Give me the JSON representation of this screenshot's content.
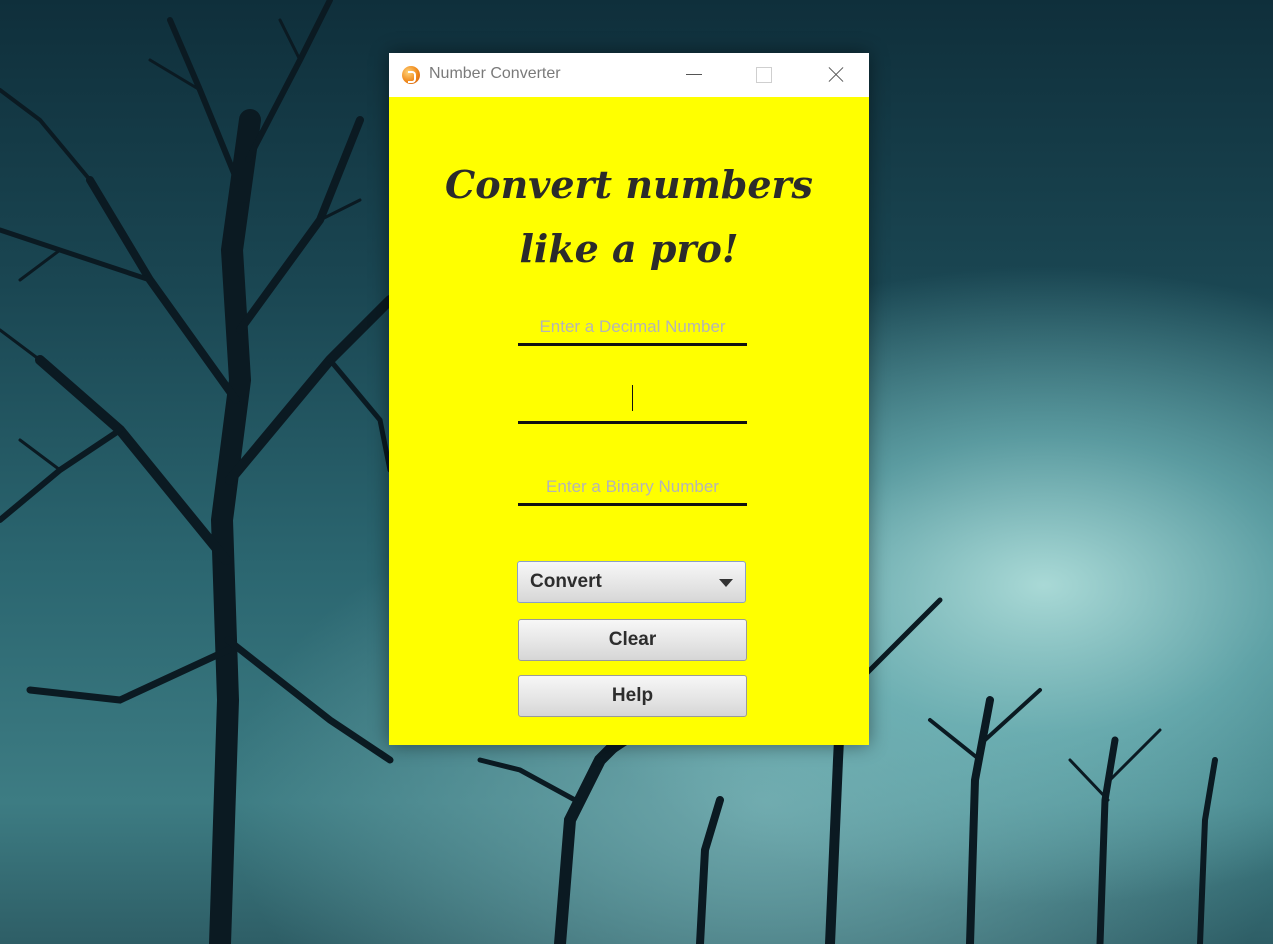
{
  "window": {
    "title": "Number Converter",
    "background_color": "#ffff00"
  },
  "main": {
    "headline_line1": "Convert numbers",
    "headline_line2": "like a pro!",
    "decimal_placeholder": "Enter a Decimal Number",
    "middle_value": "",
    "binary_placeholder": "Enter a Binary Number",
    "convert_label": "Convert",
    "clear_label": "Clear",
    "help_label": "Help"
  },
  "icons": {
    "app": "app-icon",
    "minimize": "minimize-icon",
    "maximize": "maximize-icon",
    "close": "close-icon",
    "dropdown": "chevron-down-icon"
  }
}
